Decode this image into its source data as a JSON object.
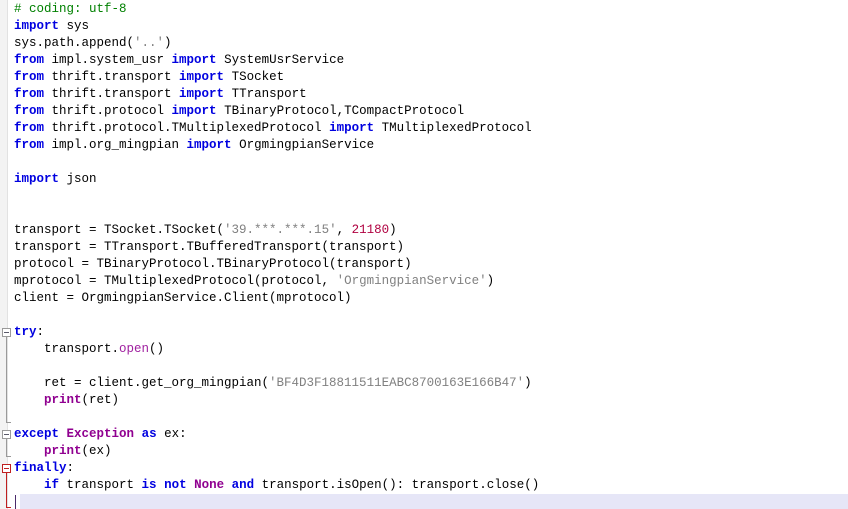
{
  "editor": {
    "language": "Python",
    "encoding_declaration": "# coding: utf-8",
    "font_family_kind": "monospace",
    "colors": {
      "background": "#ffffff",
      "gutter": "#f3f3f3",
      "comment": "#008000",
      "keyword": "#0000e0",
      "builtin": "#900090",
      "function": "#a020a0",
      "string": "#808080",
      "number": "#b00040",
      "plain_text": "#000000",
      "current_line_highlight": "#e6e6f7",
      "fold_marker_gray": "#9a9a9a",
      "fold_marker_red": "#c02020",
      "caret": "#4a2a6a"
    },
    "current_line_number": 29,
    "caret_column": 1
  },
  "fold_markers": [
    {
      "name": "try-fold",
      "line": 19,
      "state": "expanded",
      "color": "gray",
      "span_lines": 5
    },
    {
      "name": "except-fold",
      "line": 25,
      "state": "expanded",
      "color": "gray",
      "span_lines": 1
    },
    {
      "name": "finally-fold",
      "line": 27,
      "state": "expanded",
      "color": "red",
      "span_lines": 2
    }
  ],
  "code_lines": [
    {
      "n": 1,
      "tokens": [
        {
          "t": "comment",
          "s": "# coding: utf-8"
        }
      ]
    },
    {
      "n": 2,
      "tokens": [
        {
          "t": "kw",
          "s": "import"
        },
        {
          "t": "plain",
          "s": " sys"
        }
      ]
    },
    {
      "n": 3,
      "tokens": [
        {
          "t": "plain",
          "s": "sys.path.append("
        },
        {
          "t": "string",
          "s": "'..'"
        },
        {
          "t": "plain",
          "s": ")"
        }
      ]
    },
    {
      "n": 4,
      "tokens": [
        {
          "t": "kw",
          "s": "from"
        },
        {
          "t": "plain",
          "s": " impl.system_usr "
        },
        {
          "t": "kw",
          "s": "import"
        },
        {
          "t": "plain",
          "s": " SystemUsrService"
        }
      ]
    },
    {
      "n": 5,
      "tokens": [
        {
          "t": "kw",
          "s": "from"
        },
        {
          "t": "plain",
          "s": " thrift.transport "
        },
        {
          "t": "kw",
          "s": "import"
        },
        {
          "t": "plain",
          "s": " TSocket"
        }
      ]
    },
    {
      "n": 6,
      "tokens": [
        {
          "t": "kw",
          "s": "from"
        },
        {
          "t": "plain",
          "s": " thrift.transport "
        },
        {
          "t": "kw",
          "s": "import"
        },
        {
          "t": "plain",
          "s": " TTransport"
        }
      ]
    },
    {
      "n": 7,
      "tokens": [
        {
          "t": "kw",
          "s": "from"
        },
        {
          "t": "plain",
          "s": " thrift.protocol "
        },
        {
          "t": "kw",
          "s": "import"
        },
        {
          "t": "plain",
          "s": " TBinaryProtocol,TCompactProtocol"
        }
      ]
    },
    {
      "n": 8,
      "tokens": [
        {
          "t": "kw",
          "s": "from"
        },
        {
          "t": "plain",
          "s": " thrift.protocol.TMultiplexedProtocol "
        },
        {
          "t": "kw",
          "s": "import"
        },
        {
          "t": "plain",
          "s": " TMultiplexedProtocol"
        }
      ]
    },
    {
      "n": 9,
      "tokens": [
        {
          "t": "kw",
          "s": "from"
        },
        {
          "t": "plain",
          "s": " impl.org_mingpian "
        },
        {
          "t": "kw",
          "s": "import"
        },
        {
          "t": "plain",
          "s": " OrgmingpianService"
        }
      ]
    },
    {
      "n": 10,
      "tokens": []
    },
    {
      "n": 11,
      "tokens": [
        {
          "t": "kw",
          "s": "import"
        },
        {
          "t": "plain",
          "s": " json"
        }
      ]
    },
    {
      "n": 12,
      "tokens": []
    },
    {
      "n": 13,
      "tokens": []
    },
    {
      "n": 14,
      "tokens": [
        {
          "t": "plain",
          "s": "transport = TSocket.TSocket("
        },
        {
          "t": "string",
          "s": "'39.***.***.15'"
        },
        {
          "t": "plain",
          "s": ", "
        },
        {
          "t": "number",
          "s": "21180"
        },
        {
          "t": "plain",
          "s": ")"
        }
      ]
    },
    {
      "n": 15,
      "tokens": [
        {
          "t": "plain",
          "s": "transport = TTransport.TBufferedTransport(transport)"
        }
      ]
    },
    {
      "n": 16,
      "tokens": [
        {
          "t": "plain",
          "s": "protocol = TBinaryProtocol.TBinaryProtocol(transport)"
        }
      ]
    },
    {
      "n": 17,
      "tokens": [
        {
          "t": "plain",
          "s": "mprotocol = TMultiplexedProtocol(protocol, "
        },
        {
          "t": "string",
          "s": "'OrgmingpianService'"
        },
        {
          "t": "plain",
          "s": ")"
        }
      ]
    },
    {
      "n": 18,
      "tokens": [
        {
          "t": "plain",
          "s": "client = OrgmingpianService.Client(mprotocol)"
        }
      ]
    },
    {
      "n": 19,
      "tokens": []
    },
    {
      "n": 20,
      "tokens": [
        {
          "t": "kw",
          "s": "try"
        },
        {
          "t": "plain",
          "s": ":"
        }
      ]
    },
    {
      "n": 21,
      "tokens": [
        {
          "t": "plain",
          "s": "    transport."
        },
        {
          "t": "func",
          "s": "open"
        },
        {
          "t": "plain",
          "s": "()"
        }
      ]
    },
    {
      "n": 22,
      "tokens": []
    },
    {
      "n": 23,
      "tokens": [
        {
          "t": "plain",
          "s": "    ret = client.get_org_mingpian("
        },
        {
          "t": "string",
          "s": "'BF4D3F18811511EABC8700163E166B47'"
        },
        {
          "t": "plain",
          "s": ")"
        }
      ]
    },
    {
      "n": 24,
      "tokens": [
        {
          "t": "plain",
          "s": "    "
        },
        {
          "t": "builtin",
          "s": "print"
        },
        {
          "t": "plain",
          "s": "(ret)"
        }
      ]
    },
    {
      "n": 25,
      "tokens": []
    },
    {
      "n": 26,
      "tokens": [
        {
          "t": "kw",
          "s": "except"
        },
        {
          "t": "plain",
          "s": " "
        },
        {
          "t": "builtin",
          "s": "Exception"
        },
        {
          "t": "plain",
          "s": " "
        },
        {
          "t": "kw",
          "s": "as"
        },
        {
          "t": "plain",
          "s": " ex:"
        }
      ]
    },
    {
      "n": 27,
      "tokens": [
        {
          "t": "plain",
          "s": "    "
        },
        {
          "t": "builtin",
          "s": "print"
        },
        {
          "t": "plain",
          "s": "(ex)"
        }
      ]
    },
    {
      "n": 28,
      "tokens": [
        {
          "t": "kw",
          "s": "finally"
        },
        {
          "t": "plain",
          "s": ":"
        }
      ]
    },
    {
      "n": 29,
      "tokens": [
        {
          "t": "plain",
          "s": "    "
        },
        {
          "t": "kw",
          "s": "if"
        },
        {
          "t": "plain",
          "s": " transport "
        },
        {
          "t": "kw",
          "s": "is"
        },
        {
          "t": "plain",
          "s": " "
        },
        {
          "t": "kw",
          "s": "not"
        },
        {
          "t": "plain",
          "s": " "
        },
        {
          "t": "builtin",
          "s": "None"
        },
        {
          "t": "plain",
          "s": " "
        },
        {
          "t": "kw",
          "s": "and"
        },
        {
          "t": "plain",
          "s": " transport.isOpen(): transport.close()"
        }
      ]
    },
    {
      "n": 30,
      "tokens": []
    }
  ]
}
